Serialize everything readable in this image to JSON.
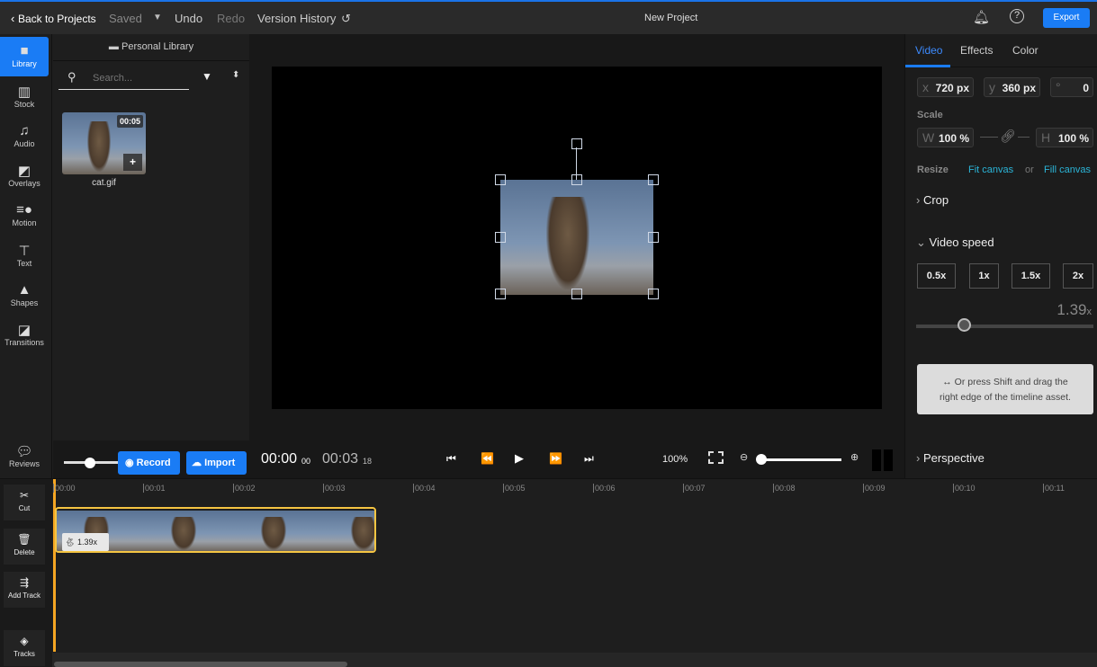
{
  "topbar": {
    "back": "Back to Projects",
    "saved": "Saved",
    "undo": "Undo",
    "redo": "Redo",
    "version_history": "Version History",
    "title": "New Project",
    "export": "Export"
  },
  "rail": [
    {
      "label": "Library",
      "icon": "folder-icon"
    },
    {
      "label": "Stock",
      "icon": "books-icon"
    },
    {
      "label": "Audio",
      "icon": "music-icon"
    },
    {
      "label": "Overlays",
      "icon": "overlay-icon"
    },
    {
      "label": "Motion",
      "icon": "motion-icon"
    },
    {
      "label": "Text",
      "icon": "text-icon"
    },
    {
      "label": "Shapes",
      "icon": "shapes-icon"
    },
    {
      "label": "Transitions",
      "icon": "transitions-icon"
    },
    {
      "label": "Reviews",
      "icon": "reviews-icon"
    }
  ],
  "library": {
    "title": "Personal Library",
    "search_placeholder": "Search...",
    "items": [
      {
        "name": "cat.gif",
        "duration": "00:05"
      }
    ]
  },
  "controls": {
    "record": "Record",
    "import": "Import",
    "current_time": "00:00",
    "current_frames": "00",
    "total_time": "00:03",
    "total_frames": "18",
    "zoom": "100%",
    "timeline_zoom": 0,
    "library_slider": 0.6
  },
  "right": {
    "tabs": [
      "Video",
      "Effects",
      "Color"
    ],
    "active_tab": "Video",
    "x_label": "x",
    "x": "720 px",
    "y_label": "y",
    "y": "360 px",
    "rot_label": "°",
    "rotation": "0",
    "scale_label": "Scale",
    "w_label": "W",
    "w": "100 %",
    "h_label": "H",
    "h": "100 %",
    "resize_label": "Resize",
    "fit": "Fit canvas",
    "or": "or",
    "fill": "Fill canvas",
    "crop": "Crop",
    "video_speed": "Video speed",
    "speeds": [
      "0.5x",
      "1x",
      "1.5x",
      "2x"
    ],
    "speed_value": "1.39",
    "speed_unit": "x",
    "hint_line1": "↔ Or press Shift and drag the",
    "hint_line2": "right edge of the timeline asset.",
    "perspective": "Perspective",
    "accent": "#1a7cf5",
    "link_color": "#2bb5d8"
  },
  "timeline": {
    "tools": [
      "Cut",
      "Delete",
      "Add Track",
      "Tracks"
    ],
    "ticks": [
      "00:00",
      "00:01",
      "00:02",
      "00:03",
      "00:04",
      "00:05",
      "00:06",
      "00:07",
      "00:08",
      "00:09",
      "00:10",
      "00:11"
    ],
    "clip_speed": "1.39x",
    "clip_border": "#f5c542"
  }
}
